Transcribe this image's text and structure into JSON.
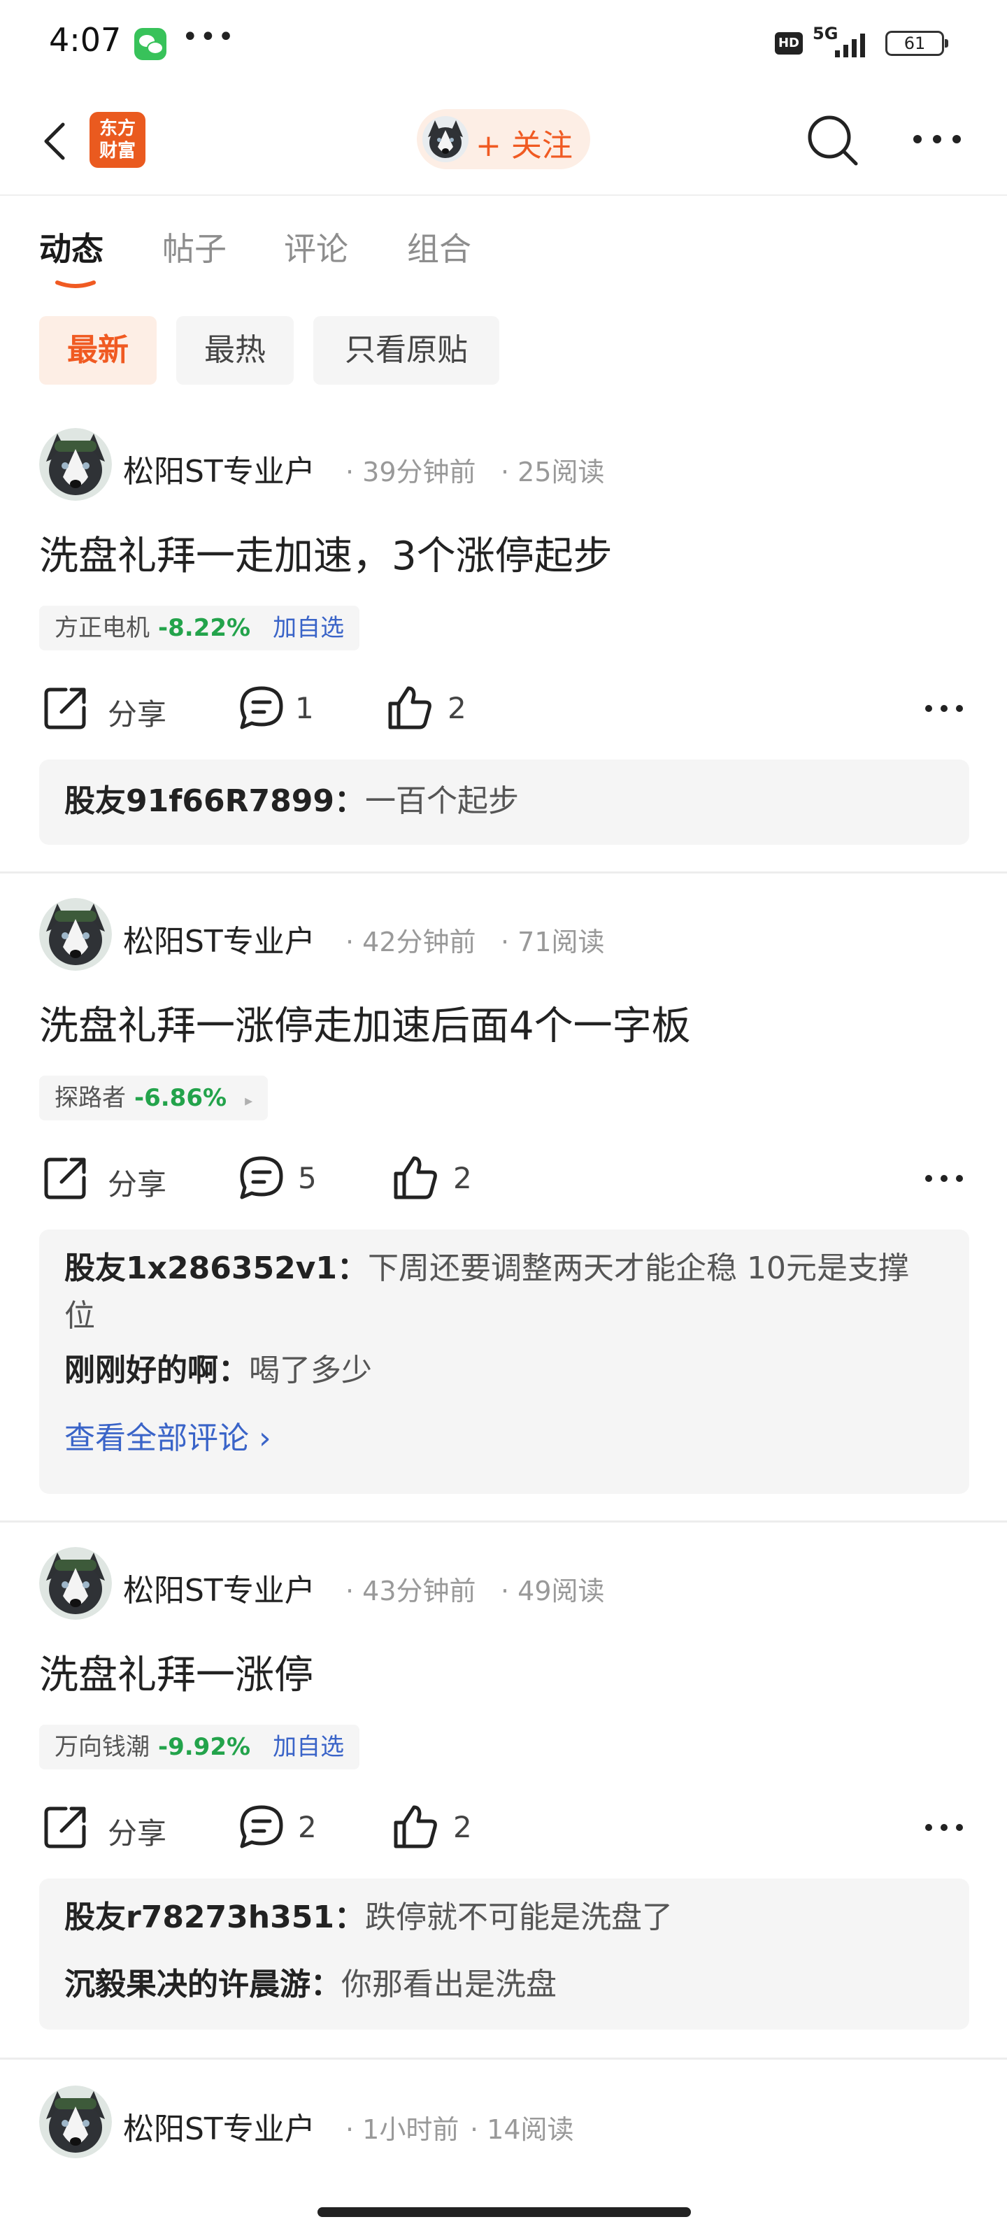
{
  "status_bar": {
    "time": "4:07",
    "dots": "•••",
    "hd": "HD",
    "network": "5G",
    "battery": "61"
  },
  "header": {
    "logo_text_1": "东方",
    "logo_text_2": "财富",
    "follow_label": "+ 关注"
  },
  "tabs": [
    "动态",
    "帖子",
    "评论",
    "组合"
  ],
  "filters": [
    "最新",
    "最热",
    "只看原贴"
  ],
  "posts": [
    {
      "author": "松阳ST专业户",
      "time": "· 39分钟前",
      "reads": "· 25阅读",
      "text": "洗盘礼拜一走加速，3个涨停起步",
      "stock": {
        "name": "方正电机",
        "change": "-8.22%",
        "action": "加自选"
      },
      "share": "分享",
      "comments": "1",
      "likes": "2",
      "replies": [
        {
          "user": "股友91f66R7899：",
          "text": "一百个起步"
        }
      ]
    },
    {
      "author": "松阳ST专业户",
      "time": "· 42分钟前",
      "reads": "· 71阅读",
      "text": "洗盘礼拜一涨停走加速后面4个一字板",
      "stock": {
        "name": "探路者",
        "change": "-6.86%",
        "arrow": "▸"
      },
      "share": "分享",
      "comments": "5",
      "likes": "2",
      "replies": [
        {
          "user": "股友1x286352v1：",
          "text": "下周还要调整两天才能企稳 10元是支撑位"
        },
        {
          "user": "刚刚好的啊：",
          "text": "喝了多少"
        }
      ],
      "view_all": "查看全部评论 ›"
    },
    {
      "author": "松阳ST专业户",
      "time": "· 43分钟前",
      "reads": "· 49阅读",
      "text": "洗盘礼拜一涨停",
      "stock": {
        "name": "万向钱潮",
        "change": "-9.92%",
        "action": "加自选"
      },
      "share": "分享",
      "comments": "2",
      "likes": "2",
      "replies": [
        {
          "user": "股友r78273h351：",
          "text": "跌停就不可能是洗盘了"
        },
        {
          "user": "沉毅果决的许晨游：",
          "text": "你那看出是洗盘"
        }
      ]
    },
    {
      "author": "松阳ST专业户",
      "time": "· 1小时前",
      "reads": "· 14阅读"
    }
  ],
  "colors": {
    "accent": "#f05a22",
    "stock_down": "#23a34b",
    "link": "#3a64c8",
    "brand_logo": "#ea5a1f"
  }
}
